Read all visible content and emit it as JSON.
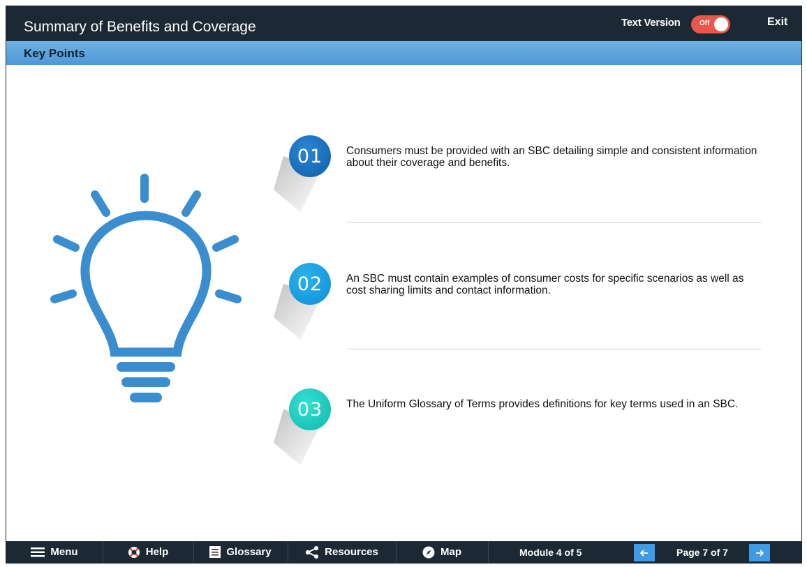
{
  "header": {
    "title": "Summary of Benefits and Coverage",
    "text_version_label": "Text Version",
    "toggle_state": "Off",
    "exit_label": "Exit"
  },
  "section": {
    "title": "Key Points"
  },
  "points": [
    {
      "number": "01",
      "text": "Consumers must be provided with an SBC detailing simple and consistent information about their coverage and benefits."
    },
    {
      "number": "02",
      "text": "An SBC must contain examples of consumer costs for specific scenarios as well as cost sharing limits and contact information."
    },
    {
      "number": "03",
      "text": "The Uniform Glossary of Terms provides definitions for key terms used in an SBC."
    }
  ],
  "footer": {
    "menu_label": "Menu",
    "help_label": "Help",
    "glossary_label": "Glossary",
    "resources_label": "Resources",
    "map_label": "Map",
    "module_info": "Module 4 of 5",
    "page_info": "Page 7 of 7"
  },
  "colors": {
    "header_bg": "#1c2833",
    "section_bar": "#4f97d6",
    "toggle_off": "#e8574a",
    "bulb": "#3a8ed0",
    "badge_1": "#1670c0",
    "badge_2": "#1a9fe0",
    "badge_3": "#1ccfc2",
    "nav_arrow": "#3f9be3"
  },
  "icons": {
    "bulb": "lightbulb-icon",
    "menu": "hamburger-icon",
    "help": "lifebuoy-icon",
    "glossary": "book-icon",
    "resources": "share-icon",
    "map": "compass-icon",
    "prev": "arrow-left-icon",
    "next": "arrow-right-icon"
  }
}
